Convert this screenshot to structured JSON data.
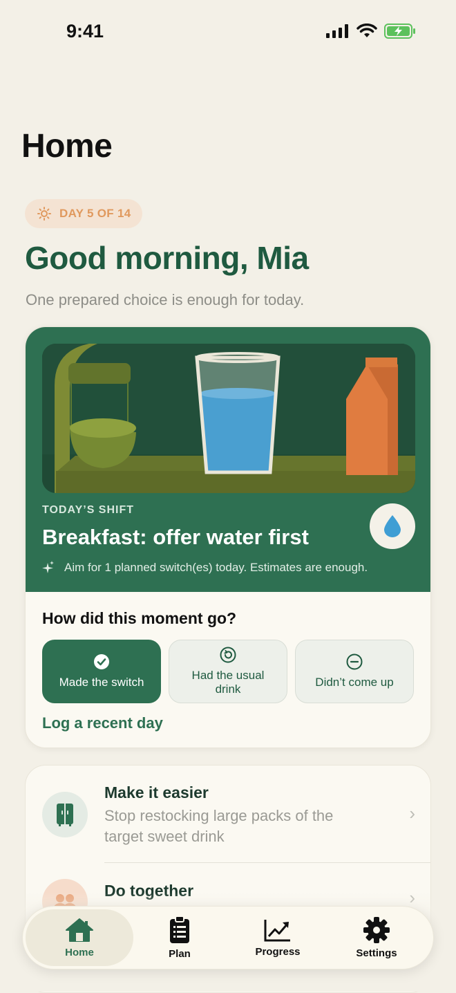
{
  "status": {
    "time": "9:41"
  },
  "page": {
    "title": "Home"
  },
  "day_badge": {
    "label": "DAY 5 OF 14"
  },
  "greeting": {
    "title": "Good morning, Mia",
    "subtitle": "One prepared choice is enough for today."
  },
  "shift_card": {
    "eyebrow": "TODAY’S SHIFT",
    "title": "Breakfast: offer water first",
    "note": "Aim for 1 planned switch(es) today. Estimates are enough.",
    "question": "How did this moment go?",
    "choices": [
      {
        "label": "Made the switch",
        "selected": true
      },
      {
        "label": "Had the usual drink",
        "selected": false
      },
      {
        "label": "Didn’t come up",
        "selected": false
      }
    ],
    "log_link": "Log a recent day"
  },
  "tips": [
    {
      "title": "Make it easier",
      "description": "Stop restocking large packs of the target sweet drink"
    },
    {
      "title": "Do together",
      "description": ""
    }
  ],
  "nav": {
    "items": [
      {
        "label": "Home",
        "icon": "home-icon",
        "active": true
      },
      {
        "label": "Plan",
        "icon": "clipboard-icon",
        "active": false
      },
      {
        "label": "Progress",
        "icon": "chart-icon",
        "active": false
      },
      {
        "label": "Settings",
        "icon": "gear-icon",
        "active": false
      }
    ]
  },
  "colors": {
    "accent": "#2e7052",
    "background": "#f3f0e7",
    "badge_text": "#e0995e"
  }
}
